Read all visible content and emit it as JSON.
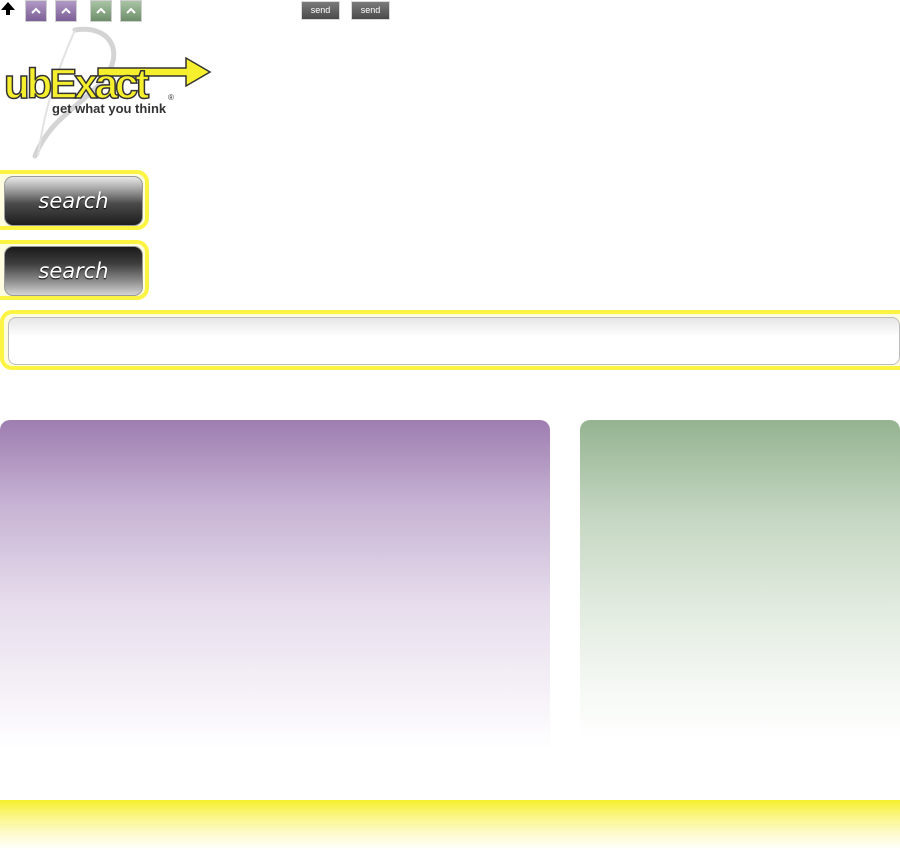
{
  "toolbar": {
    "icons": {
      "top_arrow": "up-arrow-icon",
      "scroll_up": "chevron-up-icon"
    },
    "send_buttons": [
      "send",
      "send"
    ],
    "colors": {
      "purple_button": "#7c5f96",
      "green_button": "#6e8e6b",
      "send_button": "#4a4a4a"
    }
  },
  "logo": {
    "name": "ubExact",
    "tagline": "get what you think",
    "registered_mark": "®",
    "colors": {
      "brand_yellow": "#f6ef2d",
      "outline": "#333333"
    }
  },
  "search_buttons": [
    {
      "label": "search",
      "style": "light-top"
    },
    {
      "label": "search",
      "style": "dark-top"
    }
  ],
  "search_input": {
    "value": "",
    "placeholder": ""
  },
  "theme": {
    "highlight": "#fbf442",
    "panel_purple": "#9e7db0",
    "panel_green": "#94b390"
  }
}
